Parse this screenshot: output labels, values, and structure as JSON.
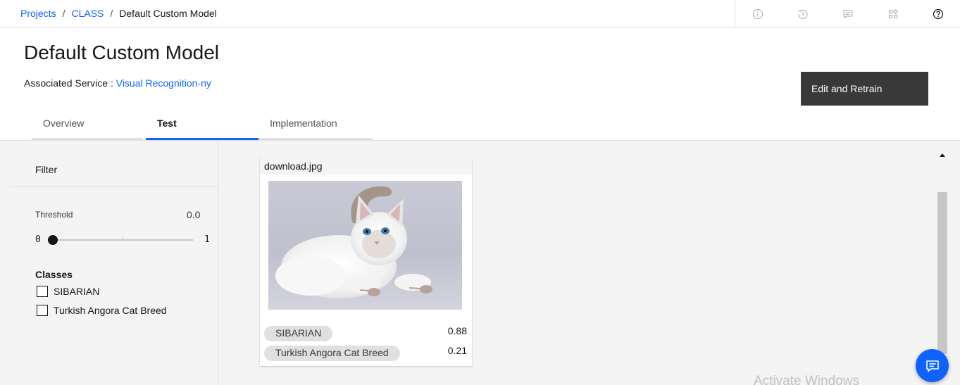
{
  "breadcrumb": {
    "items": [
      {
        "label": "Projects"
      },
      {
        "label": "CLASS"
      }
    ],
    "current": "Default Custom Model",
    "separator": "/"
  },
  "topbar_icons": [
    "info-icon",
    "history-icon",
    "comment-icon",
    "apps-icon",
    "help-icon"
  ],
  "header": {
    "title": "Default Custom Model",
    "associated_label": "Associated Service :",
    "associated_value": "Visual Recognition-ny",
    "primary_button": "Edit and Retrain"
  },
  "tabs": [
    {
      "label": "Overview",
      "selected": false
    },
    {
      "label": "Test",
      "selected": true
    },
    {
      "label": "Implementation",
      "selected": false
    }
  ],
  "filter": {
    "title": "Filter",
    "threshold_label": "Threshold",
    "threshold_value": "0.0",
    "threshold_fraction": 0,
    "range_min": "0",
    "range_max": "1",
    "classes_title": "Classes",
    "classes": [
      {
        "label": "SIBARIAN",
        "checked": false
      },
      {
        "label": "Turkish Angora Cat Breed",
        "checked": false
      }
    ]
  },
  "results": [
    {
      "filename": "download.jpg",
      "image_subject": "white fluffy kitten",
      "classes": [
        {
          "label": "SIBARIAN",
          "score": "0.88"
        },
        {
          "label": "Turkish Angora Cat Breed",
          "score": "0.21"
        }
      ]
    }
  ],
  "watermark": "Activate Windows",
  "colors": {
    "accent": "#0f62fe",
    "primary_button": "#393939",
    "content_bg": "#f4f4f4",
    "tag_bg": "#e0e0e0"
  }
}
